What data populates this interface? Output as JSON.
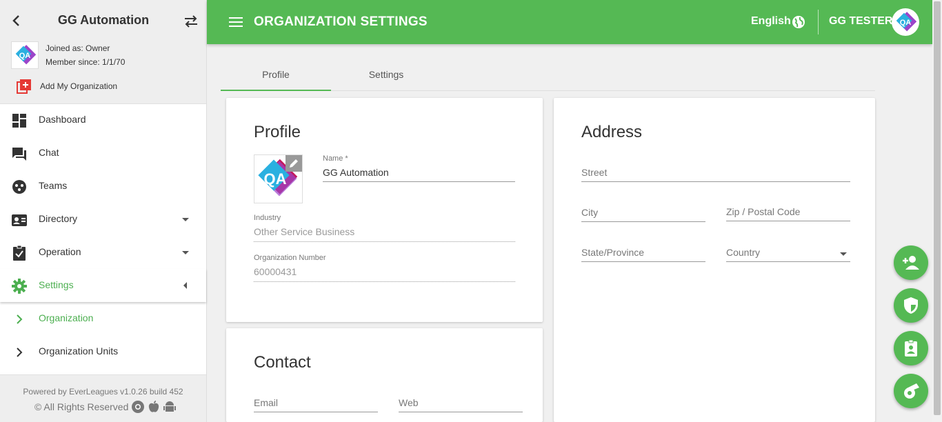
{
  "sidebar": {
    "org_title": "GG Automation",
    "joined_as": "Joined as: Owner",
    "member_since": "Member since: 1/1/70",
    "add_org_label": "Add My Organization",
    "items": [
      {
        "label": "Dashboard"
      },
      {
        "label": "Chat"
      },
      {
        "label": "Teams"
      },
      {
        "label": "Directory"
      },
      {
        "label": "Operation"
      },
      {
        "label": "Settings"
      }
    ],
    "sub_items": [
      {
        "label": "Organization"
      },
      {
        "label": "Organization Units"
      }
    ],
    "footer": {
      "powered_by": "Powered by EverLeagues v1.0.26 build 452",
      "rights": "© All Rights Reserved"
    }
  },
  "header": {
    "title": "ORGANIZATION SETTINGS",
    "language": "English",
    "user": "GG TESTER"
  },
  "tabs": [
    {
      "label": "Profile"
    },
    {
      "label": "Settings"
    }
  ],
  "profile": {
    "heading": "Profile",
    "name_label": "Name *",
    "name_value": "GG Automation",
    "industry_label": "Industry",
    "industry_value": "Other Service Business",
    "org_number_label": "Organization Number",
    "org_number_value": "60000431"
  },
  "address": {
    "heading": "Address",
    "street_placeholder": "Street",
    "city_placeholder": "City",
    "zip_placeholder": "Zip / Postal Code",
    "state_placeholder": "State/Province",
    "country_placeholder": "Country"
  },
  "contact": {
    "heading": "Contact",
    "email_placeholder": "Email",
    "web_placeholder": "Web"
  },
  "colors": {
    "brand_green": "#55b954",
    "active_text": "#4caf50"
  },
  "icons": {
    "fab_1": "add-user-icon",
    "fab_2": "shield-icon",
    "fab_3": "badge-icon",
    "fab_4": "whistle-icon"
  }
}
